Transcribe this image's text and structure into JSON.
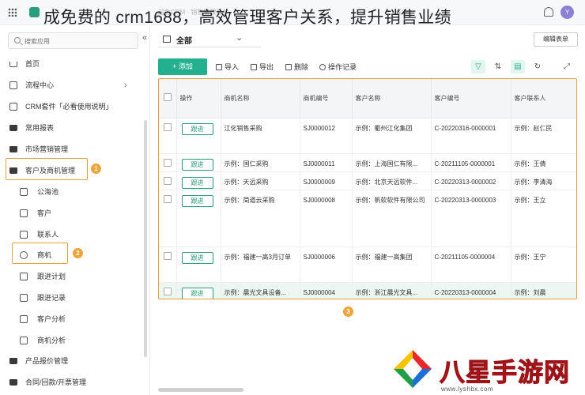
{
  "topbar": {
    "overlay_title": "成免费的 crm1688，高效管理客户关系，提升销售业绩",
    "faint_crumb": "超兔CRM · 销售管理套件",
    "faint_crumb_right": "客户",
    "avatar_letter": "Y"
  },
  "sidebar": {
    "search_placeholder": "搜索应用",
    "collapse_glyph": "«",
    "items": [
      {
        "label": "首页",
        "icon": "home-icon"
      },
      {
        "label": "流程中心",
        "icon": "flow-icon"
      },
      {
        "label": "CRM套件「必看使用说明」",
        "icon": "doc-icon"
      },
      {
        "label": "常用报表",
        "icon": "folder-icon"
      },
      {
        "label": "市场营销管理",
        "icon": "folder-icon"
      },
      {
        "label": "客户及商机管理",
        "icon": "folder-icon"
      },
      {
        "label": "公海池",
        "icon": "pool-icon"
      },
      {
        "label": "客户",
        "icon": "user-icon"
      },
      {
        "label": "联系人",
        "icon": "contact-icon"
      },
      {
        "label": "商机",
        "icon": "target-icon"
      },
      {
        "label": "跟进计划",
        "icon": "calendar-icon"
      },
      {
        "label": "跟进记录",
        "icon": "record-icon"
      },
      {
        "label": "客户分析",
        "icon": "chart-icon"
      },
      {
        "label": "商机分析",
        "icon": "chart-icon"
      },
      {
        "label": "产品报价管理",
        "icon": "folder-icon"
      },
      {
        "label": "合同/回款/开票管理",
        "icon": "folder-icon"
      }
    ],
    "markers": [
      "1",
      "2"
    ]
  },
  "viewbar": {
    "view_label": "全部",
    "caret": "⌄",
    "edit_form_label": "编辑表单"
  },
  "actionbar": {
    "add_label": "+ 添加",
    "import_label": "导入",
    "export_label": "导出",
    "delete_label": "删除",
    "log_label": "操作记录"
  },
  "table": {
    "columns": [
      "操作",
      "商机名称",
      "商机编号",
      "客户名称",
      "客户编号",
      "客户联系人"
    ],
    "follow_label": "跟进",
    "rows": [
      {
        "name": "江化销售采购",
        "code": "SJ0000012",
        "customer": "示例：衢州江化集团",
        "cust_code": "C-20220316-0000001",
        "contact": "示例：赵仁民"
      },
      {
        "name": "示例：国仁采购",
        "code": "SJ0000011",
        "customer": "示例：上海国仁有限...",
        "cust_code": "C-20211105-0000001",
        "contact": "示例：王倩"
      },
      {
        "name": "示例：天远采购",
        "code": "SJ0000009",
        "customer": "示例：北京天远软件...",
        "cust_code": "C-20220313-0000002",
        "contact": "示例：李清海"
      },
      {
        "name": "示例：简道云采购",
        "code": "SJ0000008",
        "customer": "示例：帆软软件有限公司",
        "cust_code": "C-20220313-0000003",
        "contact": "示例：王立"
      },
      {
        "name": "示例：福建一高3月订单",
        "code": "SJ0000006",
        "customer": "示例：福建一高集团",
        "cust_code": "C-20211105-0000004",
        "contact": "示例：王宁"
      },
      {
        "name": "示例：晨光文具设备...",
        "code": "SJ0000004",
        "customer": "示例：浙江晨光文具...",
        "cust_code": "C-20220313-0000004",
        "contact": "示例：刘晨"
      }
    ],
    "marker": "3"
  },
  "watermark": {
    "brand_text": "八星手游网",
    "url_text": "www.lyshbx.com"
  },
  "colors": {
    "accent": "#22b08f",
    "highlight": "#e8a13a",
    "watermark_red": "#d9252b"
  }
}
